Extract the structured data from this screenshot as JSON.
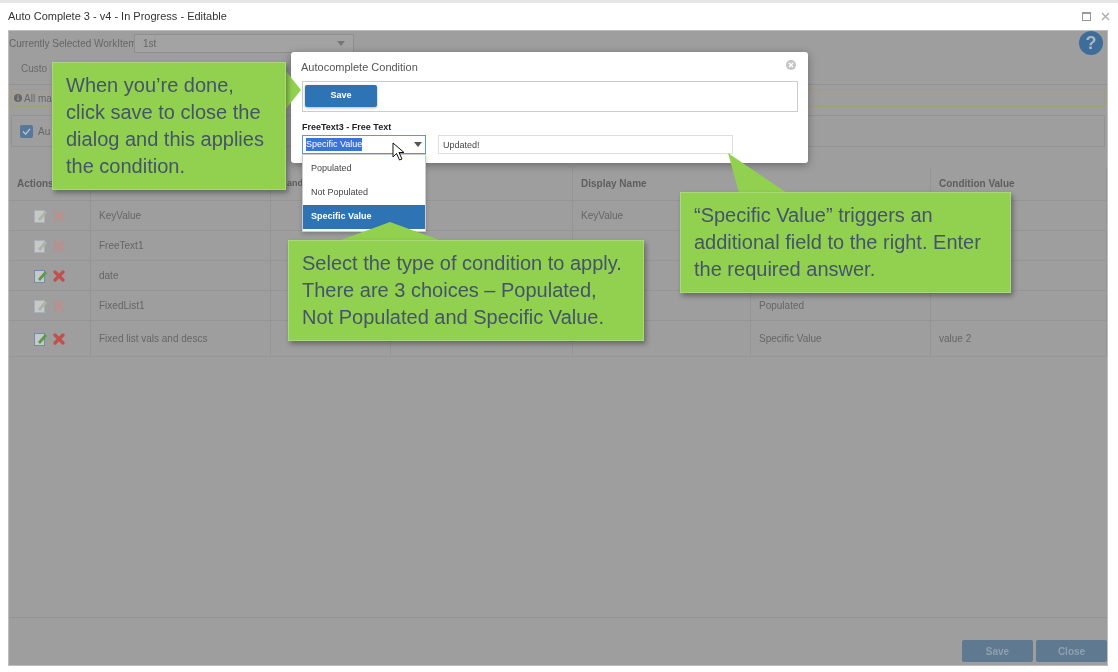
{
  "window": {
    "title": "Auto Complete 3 - v4 - In Progress - Editable"
  },
  "workitem": {
    "label": "Currently Selected WorkItem",
    "value": "1st"
  },
  "help_button": {
    "label": "?"
  },
  "tabs": [
    {
      "label": "Custo",
      "selected": false
    }
  ],
  "info_bar": {
    "text": "All ma"
  },
  "option": {
    "label": "Au",
    "checked": true
  },
  "table": {
    "columns": [
      {
        "label": "Actions"
      },
      {},
      {
        "label": "and"
      },
      {},
      {
        "label": "Display Name"
      },
      {},
      {
        "label": "Condition Value"
      }
    ],
    "rows": [
      {
        "enabled": false,
        "name": "KeyValue",
        "display_name": "KeyValue"
      },
      {
        "enabled": false,
        "name": "FreeText1"
      },
      {
        "enabled": true,
        "name": "date"
      },
      {
        "enabled": false,
        "name": "FixedList1",
        "condition": "Populated"
      },
      {
        "enabled": true,
        "name": "Fixed list vals and descs",
        "condition": "Specific Value",
        "condition_value": "value 2"
      }
    ]
  },
  "footer_buttons": [
    "Save",
    "Close"
  ],
  "dialog": {
    "title": "Autocomplete Condition",
    "save_button": "Save",
    "field_label": "FreeText3 - Free Text",
    "select_value": "Specific Value",
    "value_input": "Updated!",
    "options": [
      {
        "label": "Populated",
        "selected": false
      },
      {
        "label": "Not Populated",
        "selected": false
      },
      {
        "label": "Specific Value",
        "selected": true
      }
    ]
  },
  "callouts": [
    {
      "text": "When you’re done, click save to close the dialog and this applies the condition."
    },
    {
      "text": "Select the type of condition to apply. There are 3 choices – Populated, Not Populated and Specific Value."
    },
    {
      "text": "“Specific Value” triggers an additional field to the right. Enter the required answer."
    }
  ]
}
